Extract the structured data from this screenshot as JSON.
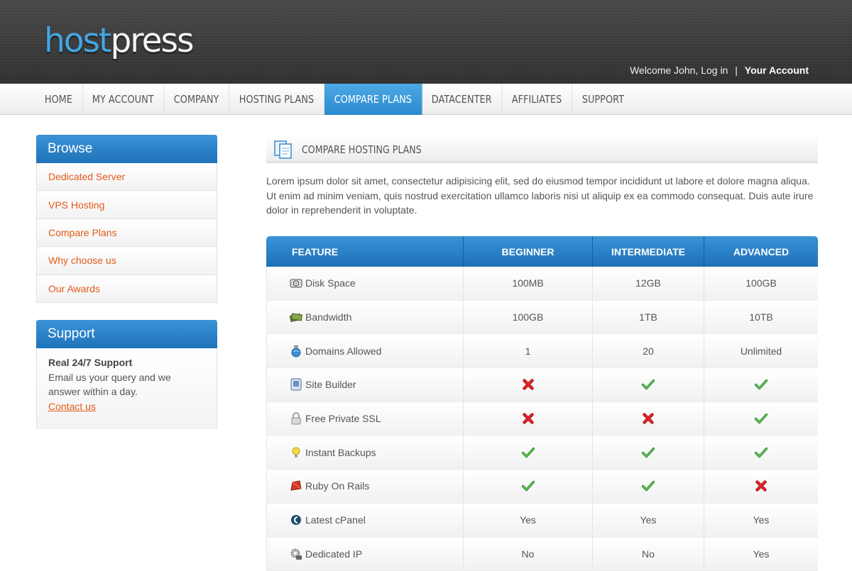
{
  "logo": {
    "part1": "host",
    "part2": "press"
  },
  "header": {
    "welcome": "Welcome John, Log in",
    "separator": "|",
    "account": "Your Account"
  },
  "nav": {
    "active": "COMPARE PLANS",
    "items": [
      "HOME",
      "MY ACCOUNT",
      "COMPANY",
      "HOSTING PLANS",
      "COMPARE PLANS",
      "DATACENTER",
      "AFFILIATES",
      "SUPPORT"
    ]
  },
  "sidebar": {
    "browse_title": "Browse",
    "browse_items": [
      "Dedicated Server",
      "VPS Hosting",
      "Compare Plans",
      "Why choose us",
      "Our Awards"
    ],
    "support_title": "Support",
    "support_heading": "Real 24/7 Support",
    "support_text": "Email us your query and we answer within a day.",
    "support_link": "Contact us"
  },
  "main": {
    "title": "COMPARE HOSTING PLANS",
    "intro": "Lorem ipsum dolor sit amet, consectetur adipisicing elit, sed do eiusmod tempor incididunt ut labore et dolore magna aliqua. Ut enim ad minim veniam, quis nostrud exercitation ullamco laboris nisi ut aliquip ex ea commodo consequat. Duis aute irure dolor in reprehenderit in voluptate."
  },
  "table": {
    "headers": [
      "FEATURE",
      "BEGINNER",
      "INTERMEDIATE",
      "ADVANCED"
    ],
    "rows": [
      {
        "icon": "hard-disk-icon",
        "feature": "Disk Space",
        "values": [
          "100MB",
          "12GB",
          "100GB"
        ]
      },
      {
        "icon": "money-icon",
        "feature": "Bandwidth",
        "values": [
          "100GB",
          "1TB",
          "10TB"
        ]
      },
      {
        "icon": "globe-icon",
        "feature": "Domains Allowed",
        "values": [
          "1",
          "20",
          "Unlimited"
        ]
      },
      {
        "icon": "site-builder-icon",
        "feature": "Site Builder",
        "values": [
          "no",
          "yes",
          "yes"
        ]
      },
      {
        "icon": "lock-icon",
        "feature": "Free Private SSL",
        "values": [
          "no",
          "no",
          "yes"
        ]
      },
      {
        "icon": "lightbulb-icon",
        "feature": "Instant Backups",
        "values": [
          "yes",
          "yes",
          "yes"
        ]
      },
      {
        "icon": "ruby-icon",
        "feature": "Ruby On Rails",
        "values": [
          "yes",
          "yes",
          "no"
        ]
      },
      {
        "icon": "cpanel-icon",
        "feature": "Latest cPanel",
        "values": [
          "Yes",
          "Yes",
          "Yes"
        ]
      },
      {
        "icon": "gear-ip-icon",
        "feature": "Dedicated IP",
        "values": [
          "No",
          "No",
          "Yes"
        ]
      }
    ]
  },
  "colors": {
    "accent_blue": "#2a8ad0",
    "link_orange": "#e25a18",
    "check_green": "#43a63a",
    "cross_red": "#d8141c"
  }
}
